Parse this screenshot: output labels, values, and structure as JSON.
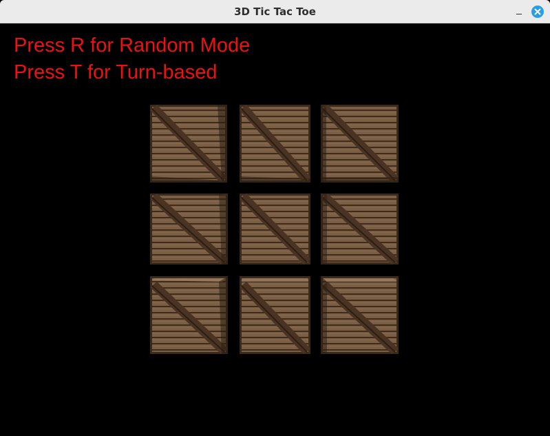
{
  "window": {
    "title": "3D Tic Tac Toe"
  },
  "instructions": {
    "random_mode": "Press R for Random Mode",
    "turn_based": "Press T for Turn-based"
  },
  "board": {
    "rows": 3,
    "cols": 3,
    "cells": [
      {
        "row": 1,
        "col": 1,
        "mark": ""
      },
      {
        "row": 1,
        "col": 2,
        "mark": ""
      },
      {
        "row": 1,
        "col": 3,
        "mark": ""
      },
      {
        "row": 2,
        "col": 1,
        "mark": ""
      },
      {
        "row": 2,
        "col": 2,
        "mark": ""
      },
      {
        "row": 2,
        "col": 3,
        "mark": ""
      },
      {
        "row": 3,
        "col": 1,
        "mark": ""
      },
      {
        "row": 3,
        "col": 2,
        "mark": ""
      },
      {
        "row": 3,
        "col": 3,
        "mark": ""
      }
    ]
  },
  "colors": {
    "instruction_text": "#ee1111",
    "background": "#000000",
    "crate_wood": "#7a5f44",
    "crate_frame": "#3b2a1c",
    "close_button": "#2a9ee5"
  }
}
